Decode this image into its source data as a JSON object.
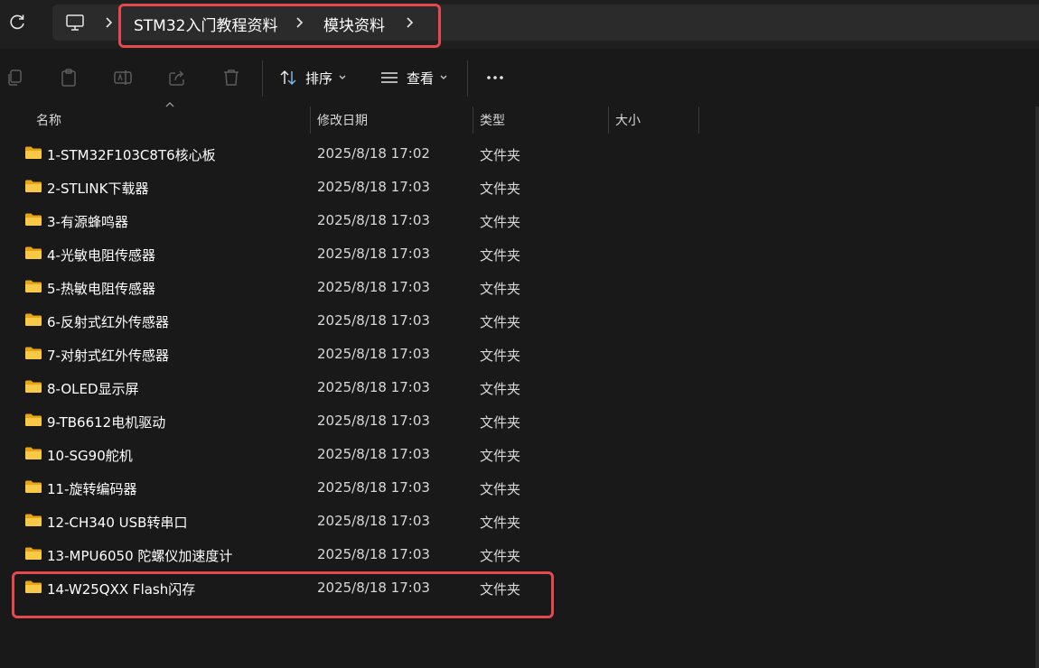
{
  "breadcrumb": {
    "items": [
      "STM32入门教程资料",
      "模块资料"
    ]
  },
  "toolbar": {
    "sort_label": "排序",
    "view_label": "查看"
  },
  "columns": {
    "name": "名称",
    "date": "修改日期",
    "type": "类型",
    "size": "大小"
  },
  "files": [
    {
      "name": "1-STM32F103C8T6核心板",
      "date": "2025/8/18 17:02",
      "type": "文件夹"
    },
    {
      "name": "2-STLINK下载器",
      "date": "2025/8/18 17:03",
      "type": "文件夹"
    },
    {
      "name": "3-有源蜂鸣器",
      "date": "2025/8/18 17:03",
      "type": "文件夹"
    },
    {
      "name": "4-光敏电阻传感器",
      "date": "2025/8/18 17:03",
      "type": "文件夹"
    },
    {
      "name": "5-热敏电阻传感器",
      "date": "2025/8/18 17:03",
      "type": "文件夹"
    },
    {
      "name": "6-反射式红外传感器",
      "date": "2025/8/18 17:03",
      "type": "文件夹"
    },
    {
      "name": "7-对射式红外传感器",
      "date": "2025/8/18 17:03",
      "type": "文件夹"
    },
    {
      "name": "8-OLED显示屏",
      "date": "2025/8/18 17:03",
      "type": "文件夹"
    },
    {
      "name": "9-TB6612电机驱动",
      "date": "2025/8/18 17:03",
      "type": "文件夹"
    },
    {
      "name": "10-SG90舵机",
      "date": "2025/8/18 17:03",
      "type": "文件夹"
    },
    {
      "name": "11-旋转编码器",
      "date": "2025/8/18 17:03",
      "type": "文件夹"
    },
    {
      "name": "12-CH340 USB转串口",
      "date": "2025/8/18 17:03",
      "type": "文件夹"
    },
    {
      "name": "13-MPU6050 陀螺仪加速度计",
      "date": "2025/8/18 17:03",
      "type": "文件夹"
    },
    {
      "name": "14-W25QXX Flash闪存",
      "date": "2025/8/18 17:03",
      "type": "文件夹"
    }
  ],
  "colors": {
    "background": "#191919",
    "address_bar": "#2b2b2b",
    "folder": "#f8c847",
    "highlight": "#e5484d"
  }
}
